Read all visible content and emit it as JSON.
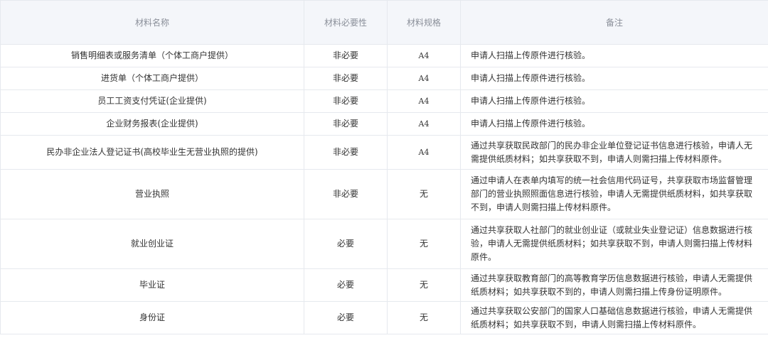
{
  "header": {
    "name": "材料名称",
    "necessity": "材料必要性",
    "spec": "材料规格",
    "remark": "备注"
  },
  "rows": [
    {
      "name": "销售明细表或服务清单（个体工商户提供）",
      "necessity": "非必要",
      "spec": "A4",
      "remark": "申请人扫描上传原件进行核验。"
    },
    {
      "name": "进货单（个体工商户提供）",
      "necessity": "非必要",
      "spec": "A4",
      "remark": "申请人扫描上传原件进行核验。"
    },
    {
      "name": "员工工资支付凭证(企业提供)",
      "necessity": "非必要",
      "spec": "A4",
      "remark": "申请人扫描上传原件进行核验。"
    },
    {
      "name": "企业财务报表(企业提供)",
      "necessity": "非必要",
      "spec": "A4",
      "remark": "申请人扫描上传原件进行核验。"
    },
    {
      "name": "民办非企业法人登记证书(高校毕业生无营业执照的提供)",
      "necessity": "非必要",
      "spec": "A4",
      "remark": "通过共享获取民政部门的民办非企业单位登记证书信息进行核验，申请人无需提供纸质材料；如共享获取不到，申请人则需扫描上传材料原件。"
    },
    {
      "name": "营业执照",
      "necessity": "非必要",
      "spec": "无",
      "remark": "通过申请人在表单内填写的统一社会信用代码证号，共享获取市场监督管理部门的营业执照照面信息进行核验，申请人无需提供纸质材料，如共享获取不到，申请人则需扫描上传材料原件。"
    },
    {
      "name": "就业创业证",
      "necessity": "必要",
      "spec": "无",
      "remark": "通过共享获取人社部门的就业创业证（或就业失业登记证）信息数据进行核验，申请人无需提供纸质材料；如共享获取不到，申请人则需扫描上传材料原件。"
    },
    {
      "name": "毕业证",
      "necessity": "必要",
      "spec": "无",
      "remark": "通过共享获取教育部门的高等教育学历信息数据进行核验，申请人无需提供纸质材料；如共享获取不到的，申请人则需扫描上传身份证明原件。"
    },
    {
      "name": "身份证",
      "necessity": "必要",
      "spec": "无",
      "remark": "通过共享获取公安部门的国家人口基础信息数据进行核验，申请人无需提供纸质材料；如共享获取不到，申请人则需扫描上传材料原件。"
    }
  ]
}
